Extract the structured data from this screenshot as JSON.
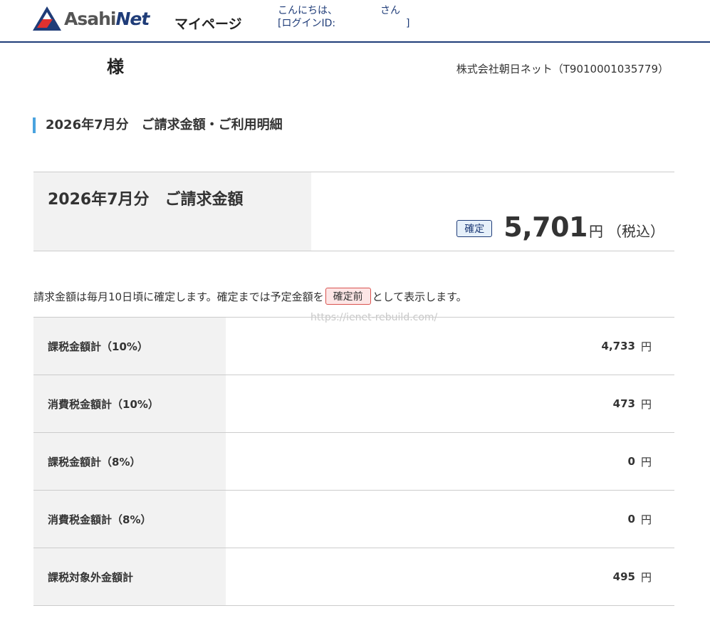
{
  "header": {
    "logo_text_a": "Asahi",
    "logo_text_b": "Net",
    "mypage_label": "マイページ",
    "greeting_hello": "こんにちは、",
    "greeting_san": "さん",
    "login_id_label": "[ログインID:",
    "login_id_close": "]",
    "brand_color": "#1f3c78"
  },
  "customer": {
    "name_suffix": "様",
    "company": "株式会社朝日ネット（T9010001035779）"
  },
  "section": {
    "title": "2026年7月分　ご請求金額・ご利用明細"
  },
  "amount": {
    "label": "2026年7月分　ご請求金額",
    "status_badge": "確定",
    "value": "5,701",
    "unit": "円",
    "tax_note": "（税込）"
  },
  "note": {
    "before": "請求金額は毎月10日頃に確定します。確定までは予定金額を",
    "badge": "確定前",
    "after": "として表示します。"
  },
  "watermark": "https://ienet-rebuild.com/",
  "breakdown": [
    {
      "label": "課税金額計（10%）",
      "value": "4,733",
      "unit": "円"
    },
    {
      "label": "消費税金額計（10%）",
      "value": "473",
      "unit": "円"
    },
    {
      "label": "課税金額計（8%）",
      "value": "0",
      "unit": "円"
    },
    {
      "label": "消費税金額計（8%）",
      "value": "0",
      "unit": "円"
    },
    {
      "label": "課税対象外金額計",
      "value": "495",
      "unit": "円"
    }
  ]
}
